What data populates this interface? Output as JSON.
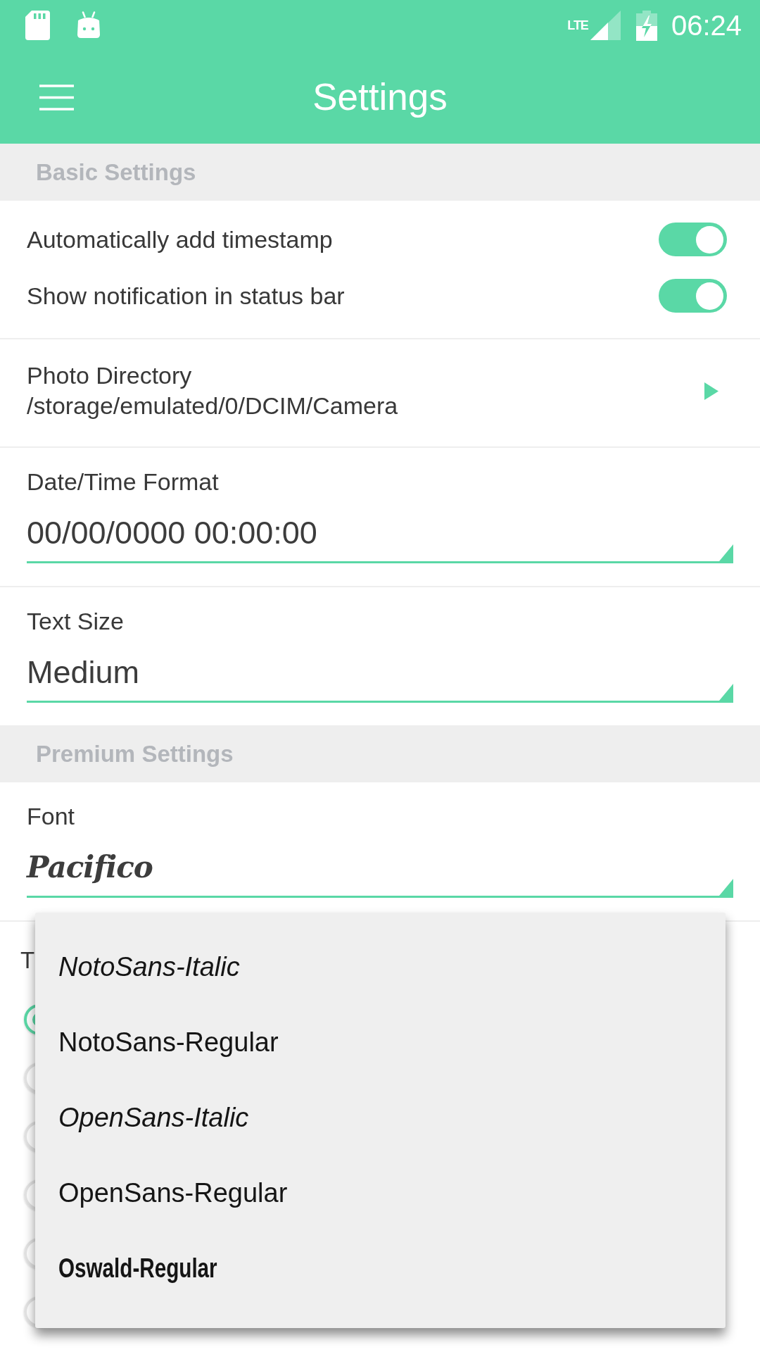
{
  "status_bar": {
    "network": "LTE",
    "time": "06:24"
  },
  "app_bar": {
    "title": "Settings"
  },
  "sections": [
    {
      "title": "Basic Settings",
      "items": [
        {
          "kind": "switch-group",
          "switches": [
            {
              "label": "Automatically add timestamp",
              "on": true
            },
            {
              "label": "Show notification in status bar",
              "on": true
            }
          ]
        },
        {
          "kind": "link",
          "label": "Photo Directory",
          "value": "/storage/emulated/0/DCIM/Camera"
        },
        {
          "kind": "select",
          "label": "Date/Time Format",
          "value": "00/00/0000 00:00:00"
        },
        {
          "kind": "select",
          "label": "Text Size",
          "value": "Medium"
        }
      ]
    },
    {
      "title": "Premium Settings",
      "items": [
        {
          "kind": "font-select",
          "label": "Font",
          "value": "Pacifico"
        },
        {
          "kind": "radio-group",
          "label": "T",
          "options": [
            {
              "selected": true
            },
            {
              "selected": false
            },
            {
              "selected": false
            },
            {
              "selected": false
            },
            {
              "selected": false
            },
            {
              "selected": false
            }
          ]
        }
      ]
    }
  ],
  "font_menu": {
    "items": [
      {
        "label": "NotoSans-Italic",
        "kind": "italic"
      },
      {
        "label": "NotoSans-Regular",
        "kind": "regular"
      },
      {
        "label": "OpenSans-Italic",
        "kind": "italic"
      },
      {
        "label": "OpenSans-Regular",
        "kind": "regular"
      },
      {
        "label": "Oswald-Regular",
        "kind": "condensed"
      }
    ]
  }
}
